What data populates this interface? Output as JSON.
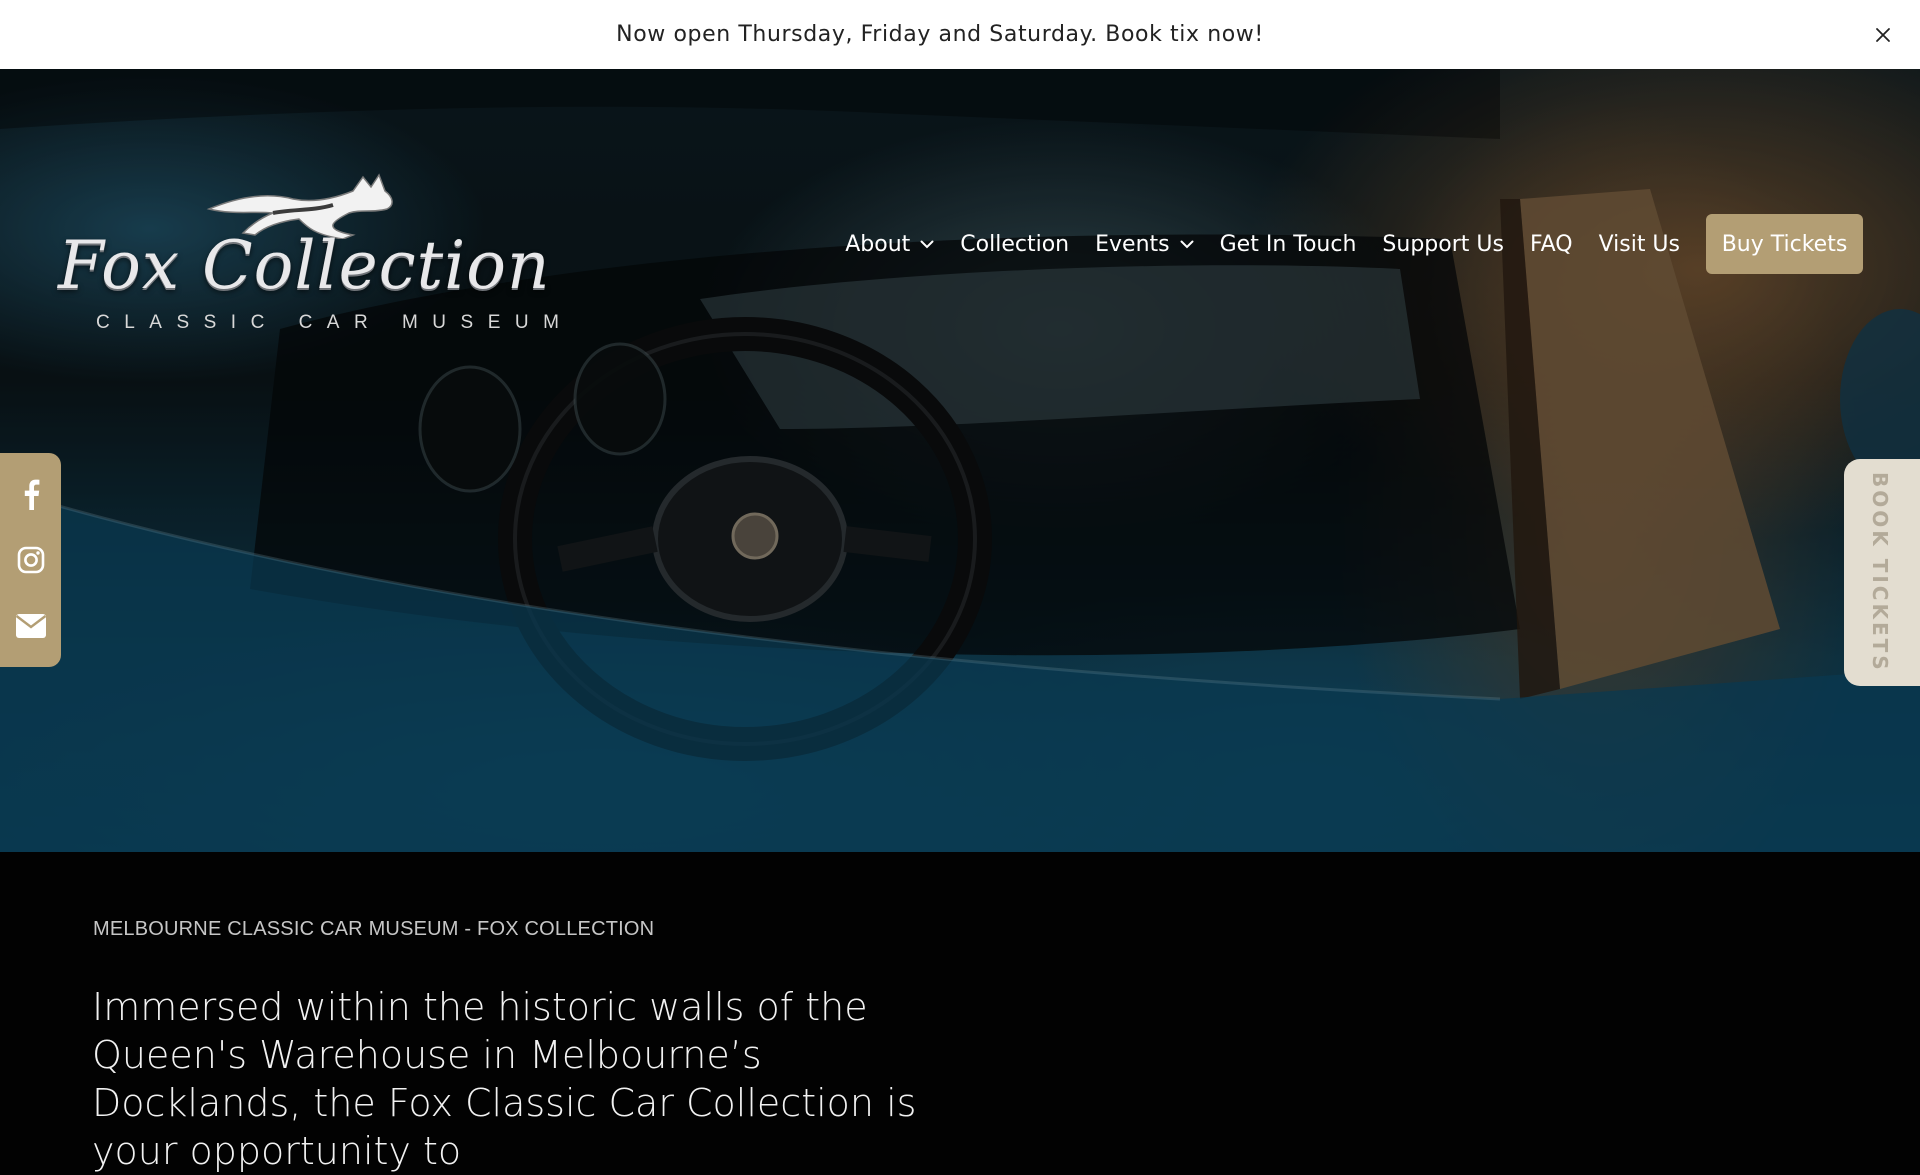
{
  "announcement": {
    "text": "Now open Thursday, Friday and Saturday. Book tix now!",
    "close_icon": "close-icon"
  },
  "logo": {
    "wordmark": "Fox Collection",
    "tagline": "CLASSIC CAR MUSEUM",
    "emblem_icon": "leaping-fox-icon"
  },
  "nav": {
    "items": [
      {
        "label": "About",
        "dropdown": true
      },
      {
        "label": "Collection",
        "dropdown": false
      },
      {
        "label": "Events",
        "dropdown": true
      },
      {
        "label": "Get In Touch",
        "dropdown": false
      },
      {
        "label": "Support Us",
        "dropdown": false
      },
      {
        "label": "FAQ",
        "dropdown": false
      },
      {
        "label": "Visit Us",
        "dropdown": false
      }
    ],
    "cta": "Buy Tickets"
  },
  "social": {
    "icons": [
      "facebook-icon",
      "instagram-icon",
      "email-icon"
    ]
  },
  "book_tab": {
    "label": "BOOK TICKETS"
  },
  "intro": {
    "eyebrow": "MELBOURNE CLASSIC CAR MUSEUM - FOX COLLECTION",
    "lead": "Immersed within the historic walls of the Queen's Warehouse in Melbourne’s Docklands, the Fox Classic Car Collection is your opportunity to"
  },
  "colors": {
    "accent": "#b39e74",
    "announcement_bg": "#ffffff",
    "page_bg": "#020202",
    "book_tab_bg": "#e3ddd0"
  }
}
